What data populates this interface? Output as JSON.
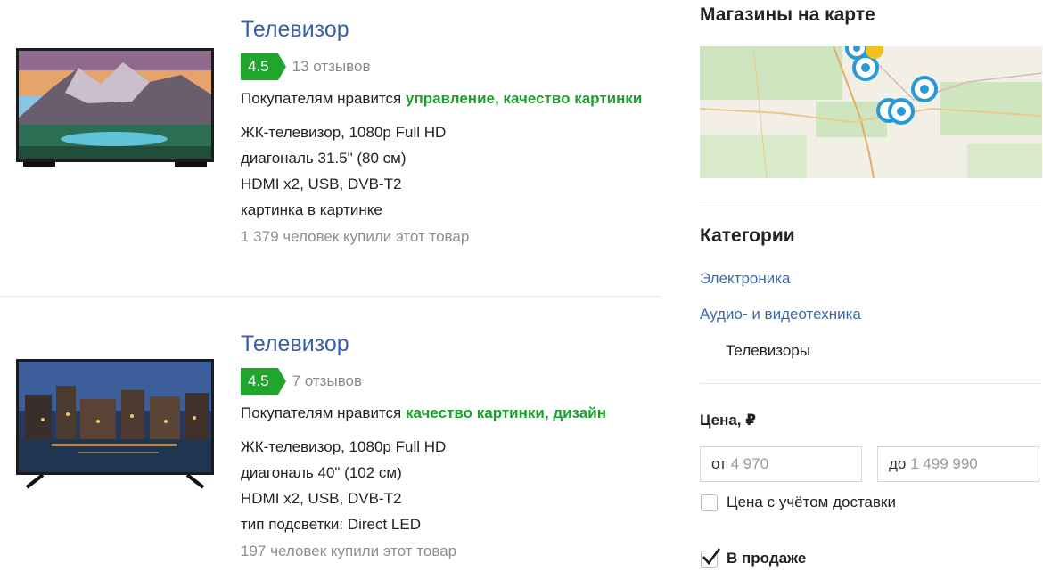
{
  "products": [
    {
      "title": "Телевизор",
      "rating": "4.5",
      "reviews": "13 отзывов",
      "likes_prefix": "Покупателям нравится",
      "likes": [
        "управление",
        "качество картинки"
      ],
      "specs": [
        "ЖК-телевизор, 1080p Full HD",
        "диагональ 31.5\" (80 см)",
        "HDMI x2, USB, DVB-T2",
        "картинка в картинке"
      ],
      "bought": "1 379 человек купили этот товар"
    },
    {
      "title": "Телевизор",
      "rating": "4.5",
      "reviews": "7 отзывов",
      "likes_prefix": "Покупателям нравится",
      "likes": [
        "качество картинки",
        "дизайн"
      ],
      "specs": [
        "ЖК-телевизор, 1080p Full HD",
        "диагональ 40\" (102 см)",
        "HDMI x2, USB, DVB-T2",
        "тип подсветки: Direct LED"
      ],
      "bought": "197 человек купили этот товар"
    }
  ],
  "sidebar": {
    "map_title": "Магазины на карте",
    "categories_title": "Категории",
    "categories": [
      "Электроника",
      "Аудио- и видеотехника"
    ],
    "current_category": "Телевизоры",
    "price_title": "Цена, ₽",
    "price_from_prefix": "от",
    "price_from_placeholder": "4 970",
    "price_to_prefix": "до",
    "price_to_placeholder": "1 499 990",
    "delivery_label": "Цена с учётом доставки",
    "delivery_checked": false,
    "on_sale_label": "В продаже",
    "on_sale_checked": true
  },
  "colors": {
    "link": "#3a5fa8",
    "rating_green": "#20a52d",
    "like_green": "#1c9f2c",
    "map_pin": "#2a9ad6"
  }
}
